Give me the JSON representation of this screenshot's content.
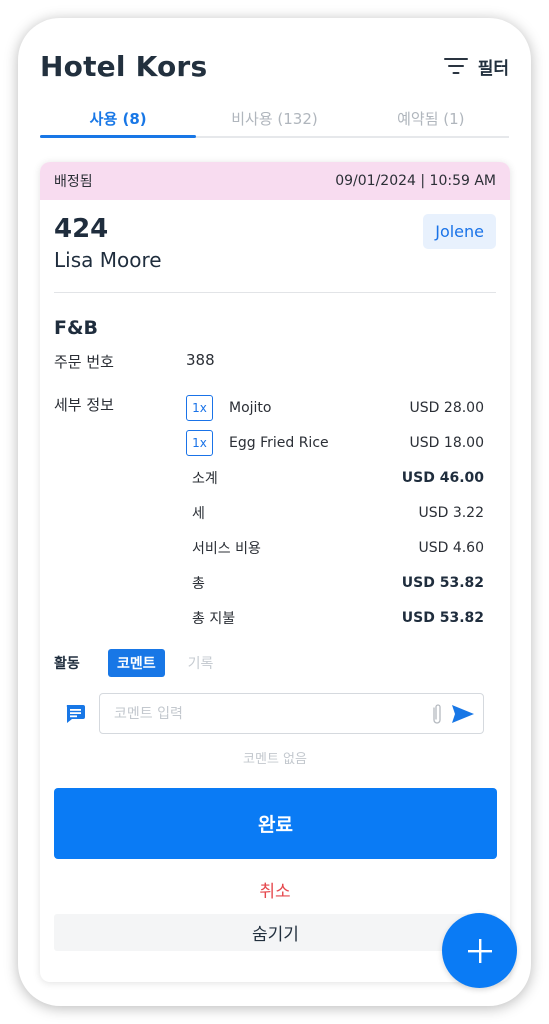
{
  "header": {
    "title": "Hotel Kors",
    "filter_label": "필터",
    "filter_icon": "filter-icon"
  },
  "tabs": [
    {
      "label": "사용 (8)",
      "active": true
    },
    {
      "label": "비사용 (132)",
      "active": false
    },
    {
      "label": "예약됨 (1)",
      "active": false
    }
  ],
  "card": {
    "status": "배정됨",
    "status_color": "#f8dcf0",
    "datetime": "09/01/2024 | 10:59 AM",
    "room_number": "424",
    "guest_name": "Lisa Moore",
    "assignee": "Jolene",
    "section_title": "F&B",
    "order_label": "주문 번호",
    "order_number": "388",
    "details_label": "세부 정보",
    "items": [
      {
        "qty": "1x",
        "name": "Mojito",
        "price": "USD 28.00"
      },
      {
        "qty": "1x",
        "name": "Egg Fried Rice",
        "price": "USD 18.00"
      }
    ],
    "summary": [
      {
        "label": "소계",
        "amount": "USD 46.00",
        "bold": true
      },
      {
        "label": "세",
        "amount": "USD 3.22",
        "bold": false
      },
      {
        "label": "서비스 비용",
        "amount": "USD 4.60",
        "bold": false
      },
      {
        "label": "총",
        "amount": "USD 53.82",
        "bold": true
      },
      {
        "label": "총 지불",
        "amount": "USD 53.82",
        "bold": true
      }
    ],
    "activity": {
      "label": "활동",
      "tabs": [
        {
          "label": "코멘트",
          "active": true
        },
        {
          "label": "기록",
          "active": false
        }
      ],
      "comment_placeholder": "코멘트 입력",
      "comment_value": "",
      "no_comments": "코멘트 없음"
    },
    "complete_label": "완료",
    "cancel_label": "취소",
    "hide_label": "숨기기"
  },
  "colors": {
    "accent": "#0a7bf5",
    "danger": "#e5484d",
    "status_bg": "#f8dcf0"
  }
}
